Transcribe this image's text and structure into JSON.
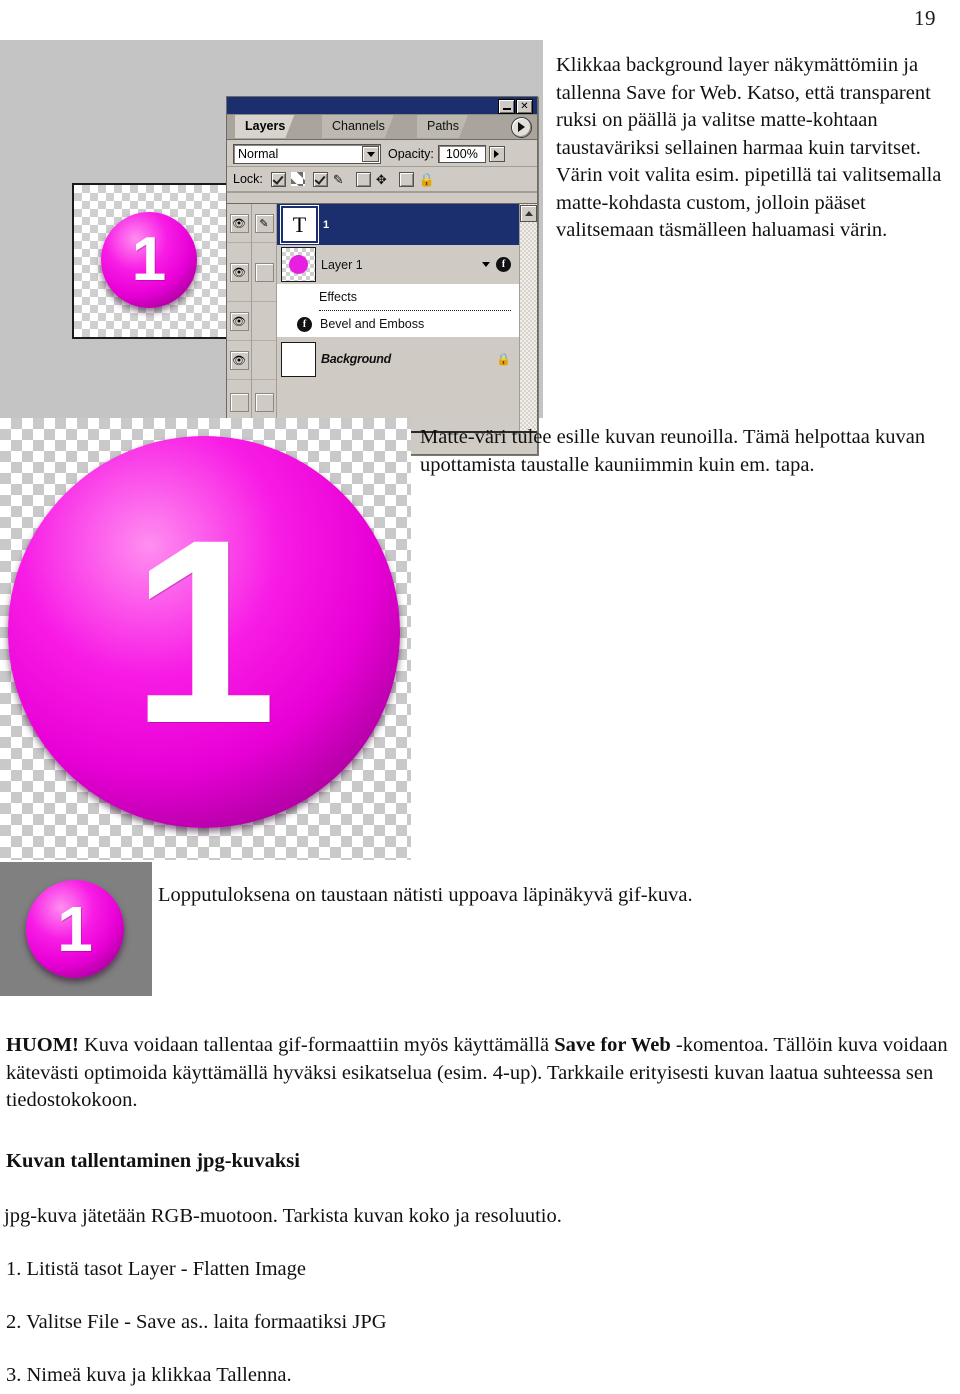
{
  "page": {
    "number": "19"
  },
  "screenshot_top": {
    "name": "photoshop-layers-palette-screenshot",
    "document_thumb_digit": "1",
    "palette": {
      "tabs": [
        {
          "label": "Layers",
          "active": true
        },
        {
          "label": "Channels",
          "active": false
        },
        {
          "label": "Paths",
          "active": false
        }
      ],
      "blend_mode": "Normal",
      "opacity_label": "Opacity:",
      "opacity_value": "100%",
      "lock_label": "Lock:",
      "lock_items": [
        {
          "icon": "transparency-icon",
          "checked": true
        },
        {
          "icon": "brush-icon",
          "checked": true
        },
        {
          "icon": "move-icon",
          "checked": false
        },
        {
          "icon": "lock-icon",
          "checked": false
        }
      ],
      "layers": [
        {
          "name": "1",
          "thumb": "T",
          "selected": true,
          "visible": true,
          "linked": true,
          "type": "text"
        },
        {
          "name": "Layer 1",
          "thumb": "magenta-circle",
          "selected": false,
          "visible": true,
          "linked": false,
          "type": "image",
          "has_effects": true,
          "effects_header": "Effects",
          "effects": [
            "Bevel and Emboss"
          ]
        },
        {
          "name": "Background",
          "thumb": "white",
          "selected": false,
          "visible": false,
          "linked": false,
          "type": "background",
          "locked": true
        }
      ]
    }
  },
  "screenshot_big": {
    "name": "transparent-gif-preview",
    "digit": "1"
  },
  "screenshot_gray": {
    "name": "matte-result-preview",
    "digit": "1",
    "background_color": "#808080"
  },
  "text": {
    "para_top": "Klikkaa background layer näkymättömiin ja tallenna Save for Web. Katso, että transparent ruksi on päällä ja valitse matte-kohtaan taustaväriksi sellainen harmaa kuin tarvitset. Värin voit valita esim. pipetillä tai valitsemalla matte-kohdasta custom, jolloin pääset valitsemaan täsmälleen haluamasi värin.",
    "para_mid": "Matte-väri tulee esille kuvan reunoilla. Tämä helpottaa kuvan upottamista taustalle kauniimmin kuin em. tapa.",
    "para_result": "Lopputuloksena on taustaan nätisti uppoava läpinäkyvä gif-kuva.",
    "huom_bold": "HUOM!",
    "huom_part1": " Kuva voidaan tallentaa gif-formaattiin myös käyttämällä ",
    "huom_bold2": "Save for Web",
    "huom_part2": " -komentoa. Tällöin kuva voidaan kätevästi optimoida käyttämällä hyväksi esikatselua (esim. 4-up). Tarkkaile erityisesti kuvan laatua suhteessa sen tiedostokokoon.",
    "head_jpg": "Kuvan tallentaminen jpg-kuvaksi",
    "para_jpg": "jpg-kuva jätetään RGB-muotoon. Tarkista kuvan koko ja resoluutio.",
    "step1": "1. Litistä tasot Layer - Flatten Image",
    "step2": "2. Valitse File - Save as.. laita formaatiksi JPG",
    "step3": "3. Nimeä kuva ja klikkaa Tallenna."
  },
  "colors": {
    "accent_magenta": "#e81ee0",
    "palette_face": "#cfcbc4",
    "titlebar_blue": "#1b2f6e",
    "matte_gray": "#808080"
  }
}
